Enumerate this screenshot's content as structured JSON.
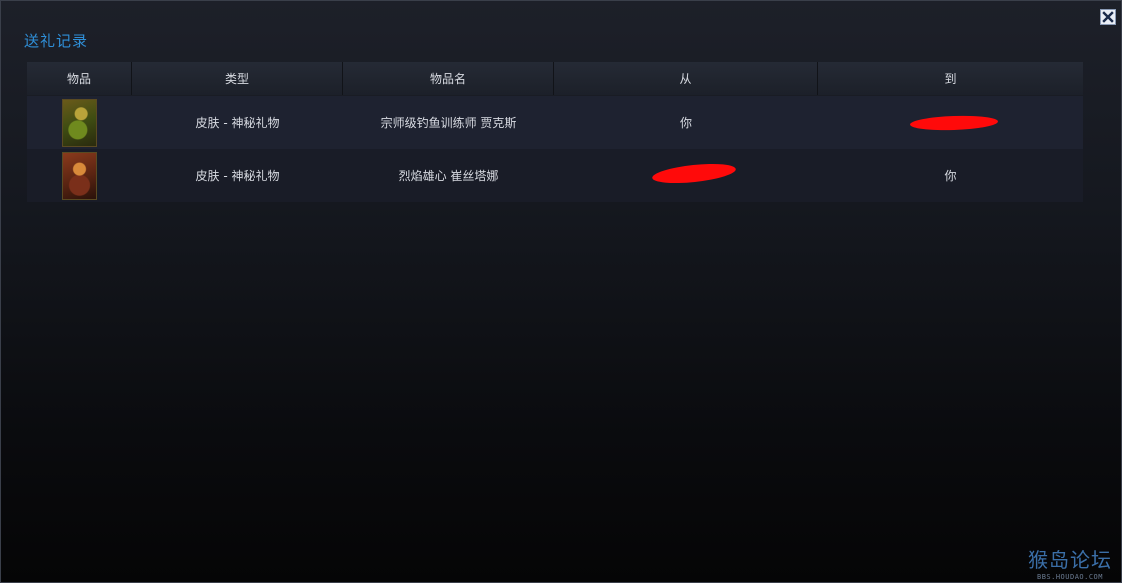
{
  "window": {
    "title": "送礼记录",
    "close_icon": "close-icon"
  },
  "table": {
    "headers": [
      "物品",
      "类型",
      "物品名",
      "从",
      "到"
    ],
    "rows": [
      {
        "item_icon": "champion-skin-thumbnail",
        "type": "皮肤 - 神秘礼物",
        "name": "宗师级钓鱼训练师 贾克斯",
        "from": "你",
        "to": ""
      },
      {
        "item_icon": "champion-skin-thumbnail",
        "type": "皮肤 - 神秘礼物",
        "name": "烈焰雄心 崔丝塔娜",
        "from": "",
        "to": "你"
      }
    ]
  },
  "watermark": {
    "logo": "猴岛论坛",
    "url": "BBS.HOUDAO.COM"
  },
  "colors": {
    "title": "#2f8fd8",
    "redaction": "#ff0a0a"
  }
}
